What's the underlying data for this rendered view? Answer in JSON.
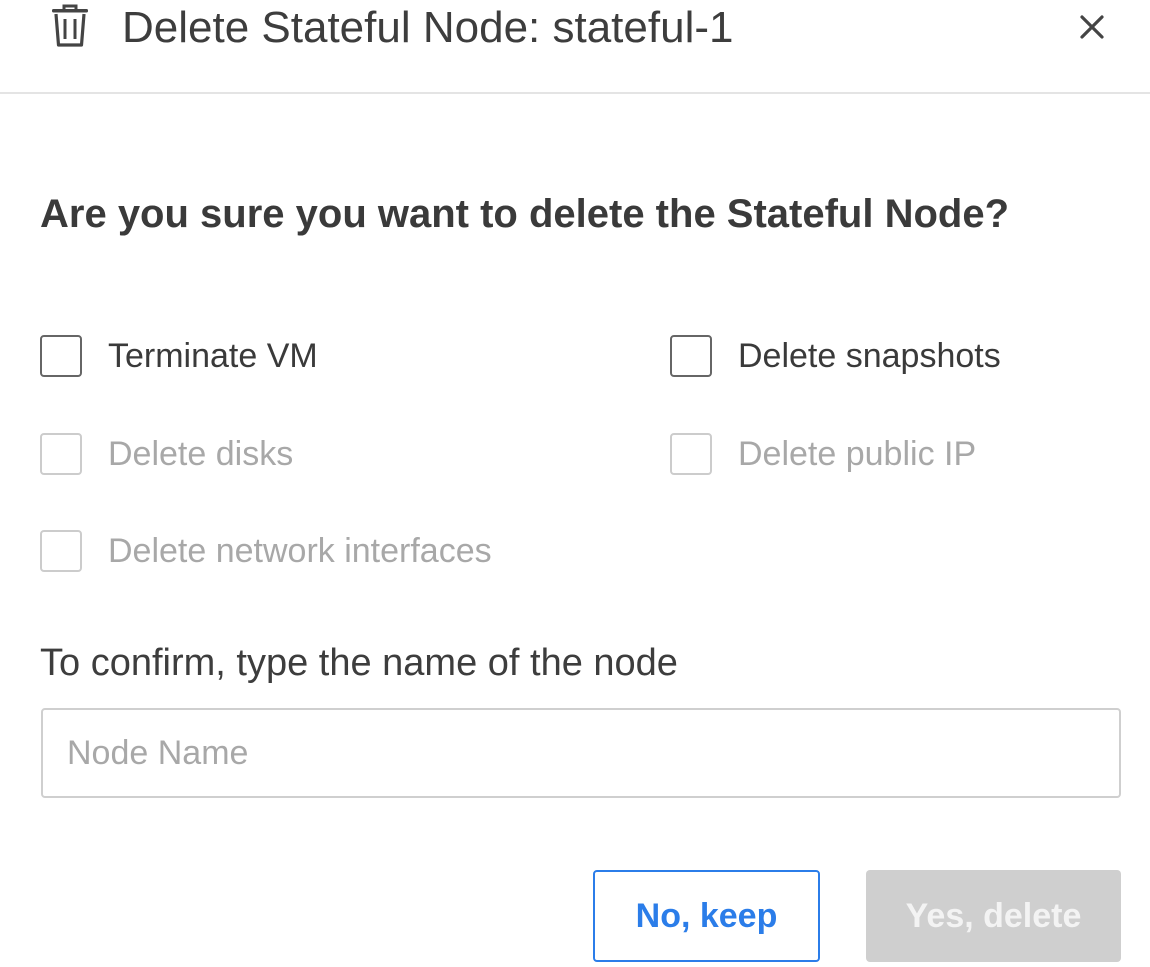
{
  "dialog": {
    "title": "Delete Stateful Node: stateful-1",
    "close_glyph": "×",
    "question": "Are you sure you want to delete the Stateful Node?",
    "options": {
      "terminate_vm": {
        "label": "Terminate VM",
        "checked": false,
        "disabled": false
      },
      "delete_snapshots": {
        "label": "Delete snapshots",
        "checked": false,
        "disabled": false
      },
      "delete_disks": {
        "label": "Delete disks",
        "checked": false,
        "disabled": true
      },
      "delete_public_ip": {
        "label": "Delete public IP",
        "checked": false,
        "disabled": true
      },
      "delete_network_interfaces": {
        "label": "Delete network interfaces",
        "checked": false,
        "disabled": true
      }
    },
    "confirm_label": "To confirm, type the name of the node",
    "name_input": {
      "value": "",
      "placeholder": "Node Name"
    },
    "buttons": {
      "keep_label": "No, keep",
      "delete_label": "Yes, delete"
    }
  },
  "icons": {
    "header_icon": "trash-icon",
    "close_icon": "close-icon"
  },
  "colors": {
    "primary": "#2b7de9",
    "disabled_button": "#cfcfcf",
    "disabled_text": "#a8a8a8",
    "text": "#3a3a3a",
    "divider": "#e4e4e4"
  }
}
